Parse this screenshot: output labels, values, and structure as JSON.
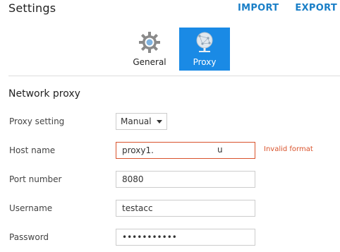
{
  "header": {
    "title": "Settings",
    "import_label": "IMPORT",
    "export_label": "EXPORT"
  },
  "tabs": [
    {
      "label": "General",
      "icon": "gear-icon",
      "active": false
    },
    {
      "label": "Proxy",
      "icon": "globe-network-icon",
      "active": true
    }
  ],
  "section": {
    "title": "Network proxy"
  },
  "form": {
    "proxy_setting": {
      "label": "Proxy setting",
      "value": "Manual"
    },
    "host_name": {
      "label": "Host name",
      "value": "proxy1.",
      "trailing": "u",
      "error": "Invalid format"
    },
    "port_number": {
      "label": "Port number",
      "value": "8080"
    },
    "username": {
      "label": "Username",
      "value": "testacc"
    },
    "password": {
      "label": "Password",
      "value": "•••••••••••"
    }
  },
  "colors": {
    "accent": "#1a8ae5",
    "link": "#1a7fc7",
    "error": "#d9532c"
  }
}
